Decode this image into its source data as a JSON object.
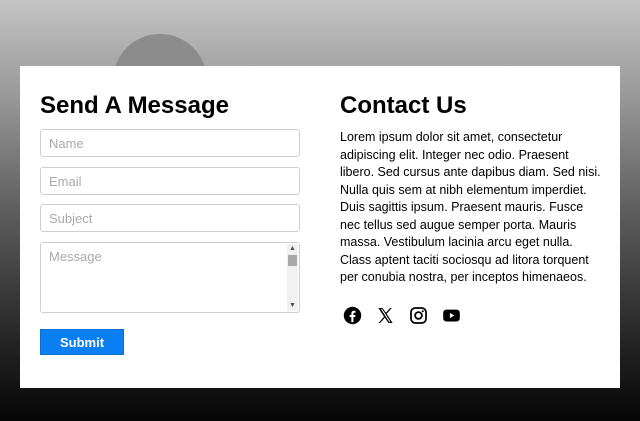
{
  "form": {
    "title": "Send A Message",
    "name_placeholder": "Name",
    "email_placeholder": "Email",
    "subject_placeholder": "Subject",
    "message_placeholder": "Message",
    "submit_label": "Submit"
  },
  "contact": {
    "title": "Contact Us",
    "body": "Lorem ipsum dolor sit amet, consectetur adipiscing elit. Integer nec odio. Praesent libero. Sed cursus ante dapibus diam. Sed nisi. Nulla quis sem at nibh elementum imperdiet. Duis sagittis ipsum. Praesent mauris. Fusce nec tellus sed augue semper porta. Mauris massa. Vestibulum lacinia arcu eget nulla. Class aptent taciti sociosqu ad litora torquent per conubia nostra, per inceptos himenaeos.",
    "social_icons": [
      "facebook-icon",
      "x-icon",
      "instagram-icon",
      "youtube-icon"
    ]
  },
  "colors": {
    "accent": "#0a7ff2"
  }
}
